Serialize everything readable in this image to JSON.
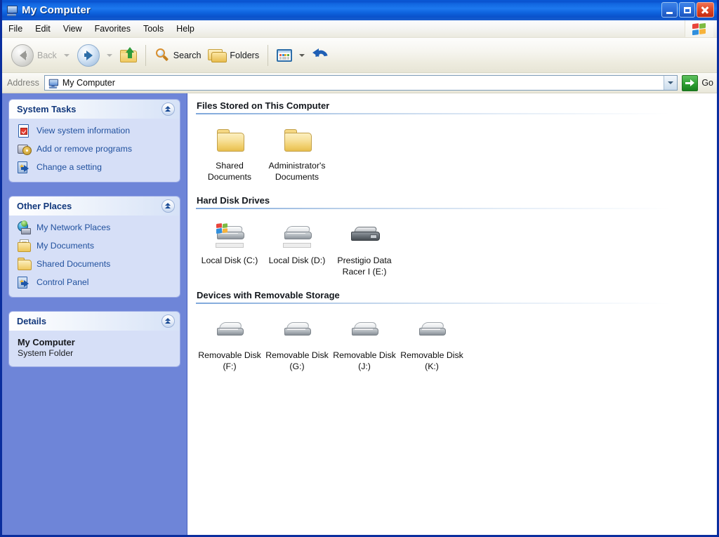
{
  "window": {
    "title": "My Computer",
    "title_icon": "my-computer-icon",
    "buttons": {
      "minimize": "minimize-icon",
      "maximize": "maximize-icon",
      "close": "close-icon"
    }
  },
  "menubar": {
    "items": [
      {
        "label": "File"
      },
      {
        "label": "Edit"
      },
      {
        "label": "View"
      },
      {
        "label": "Favorites"
      },
      {
        "label": "Tools"
      },
      {
        "label": "Help"
      }
    ],
    "brand_icon": "windows-flag-icon"
  },
  "toolbar": {
    "back_label": "Back",
    "back_icon": "back-arrow-icon",
    "back_dropdown_icon": "chevron-down-icon",
    "forward_icon": "forward-arrow-icon",
    "forward_dropdown_icon": "chevron-down-icon",
    "up_icon": "up-one-level-icon",
    "search_label": "Search",
    "search_icon": "search-magnifier-icon",
    "folders_label": "Folders",
    "folders_icon": "folders-icon",
    "views_icon": "views-icon",
    "views_dropdown_icon": "chevron-down-icon",
    "undo_icon": "undo-arrow-icon"
  },
  "address": {
    "label": "Address",
    "value": "My Computer",
    "icon": "my-computer-icon",
    "dropdown_icon": "chevron-down-icon",
    "go_label": "Go",
    "go_icon": "green-arrow-icon"
  },
  "sidebar": {
    "panels": [
      {
        "title": "System Tasks",
        "collapse_icon": "chevron-up-icon",
        "items": [
          {
            "label": "View system information",
            "icon": "system-information-icon"
          },
          {
            "label": "Add or remove programs",
            "icon": "add-remove-programs-icon"
          },
          {
            "label": "Change a setting",
            "icon": "change-setting-icon"
          }
        ]
      },
      {
        "title": "Other Places",
        "collapse_icon": "chevron-up-icon",
        "items": [
          {
            "label": "My Network Places",
            "icon": "network-places-icon"
          },
          {
            "label": "My Documents",
            "icon": "my-documents-icon"
          },
          {
            "label": "Shared Documents",
            "icon": "shared-documents-icon"
          },
          {
            "label": "Control Panel",
            "icon": "control-panel-icon"
          }
        ]
      },
      {
        "title": "Details",
        "collapse_icon": "chevron-up-icon",
        "detail_name": "My Computer",
        "detail_type": "System Folder"
      }
    ]
  },
  "content": {
    "groups": [
      {
        "heading": "Files Stored on This Computer",
        "items": [
          {
            "label": "Shared Documents",
            "icon": "folder-icon"
          },
          {
            "label": "Administrator's Documents",
            "icon": "folder-icon"
          }
        ]
      },
      {
        "heading": "Hard Disk Drives",
        "items": [
          {
            "label": "Local Disk (C:)",
            "icon": "hard-disk-system-icon"
          },
          {
            "label": "Local Disk (D:)",
            "icon": "hard-disk-icon"
          },
          {
            "label": "Prestigio Data Racer I (E:)",
            "icon": "external-hard-disk-icon"
          }
        ]
      },
      {
        "heading": "Devices with Removable Storage",
        "items": [
          {
            "label": "Removable Disk (F:)",
            "icon": "removable-disk-icon"
          },
          {
            "label": "Removable Disk (G:)",
            "icon": "removable-disk-icon"
          },
          {
            "label": "Removable Disk (J:)",
            "icon": "removable-disk-icon"
          },
          {
            "label": "Removable Disk (K:)",
            "icon": "removable-disk-icon"
          }
        ]
      }
    ]
  },
  "colors": {
    "title_bar_blue": "#1166E0",
    "window_border": "#0A2E9E",
    "sidebar_blue": "#6E85D8",
    "panel_body": "#D6DFF7",
    "link_blue": "#21519E",
    "heading_dark": "#14181E",
    "go_green": "#2E9E32"
  }
}
